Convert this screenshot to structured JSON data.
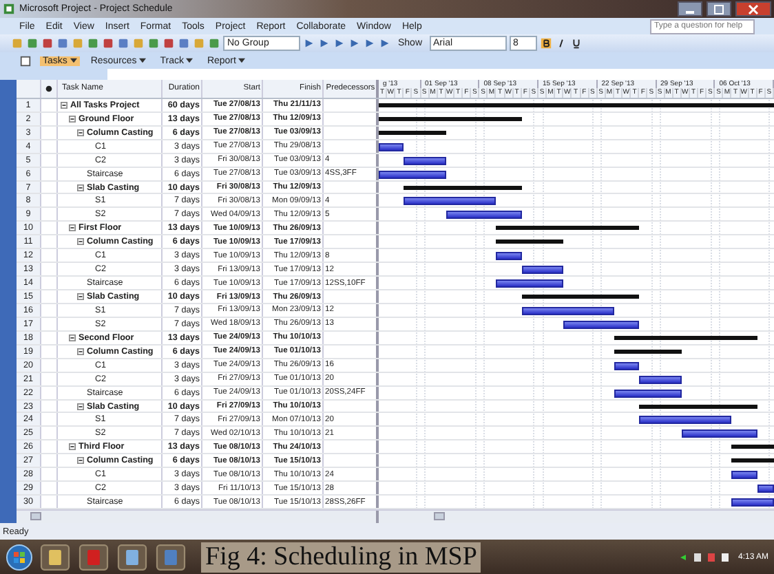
{
  "window": {
    "title": "Microsoft Project - Project Schedule"
  },
  "menu": [
    "File",
    "Edit",
    "View",
    "Insert",
    "Format",
    "Tools",
    "Project",
    "Report",
    "Collaborate",
    "Window",
    "Help"
  ],
  "help_box": {
    "placeholder": "Type a question for help"
  },
  "toolbar": {
    "group": "No Group",
    "show": "Show",
    "font": "Arial",
    "size": "8"
  },
  "view_bar": [
    {
      "label": "Tasks",
      "selected": true
    },
    {
      "label": "Resources",
      "selected": false
    },
    {
      "label": "Track",
      "selected": false
    },
    {
      "label": "Report",
      "selected": false
    }
  ],
  "table": {
    "columns": [
      "Task Name",
      "Duration",
      "Start",
      "Finish",
      "Predecessors"
    ],
    "rows": [
      {
        "num": "1",
        "name": "All Tasks Project",
        "duration": "60 days",
        "start": "Tue 27/08/13",
        "finish": "Thu 21/11/13",
        "expanded": true,
        "children": [
          {
            "num": "2",
            "name": "Ground Floor",
            "duration": "13 days",
            "start": "Tue 27/08/13",
            "finish": "Thu 12/09/13",
            "expanded": true,
            "children": [
              {
                "num": "3",
                "name": "Column Casting",
                "duration": "6 days",
                "start": "Tue 27/08/13",
                "finish": "Tue 03/09/13",
                "expanded": true,
                "children": [
                  {
                    "num": "4",
                    "name": "C1",
                    "duration": "3 days",
                    "start": "Tue 27/08/13",
                    "finish": "Thu 29/08/13"
                  },
                  {
                    "num": "5",
                    "name": "C2",
                    "duration": "3 days",
                    "start": "Fri 30/08/13",
                    "finish": "Tue 03/09/13",
                    "pred": "4"
                  }
                ]
              },
              {
                "num": "6",
                "name": "Staircase",
                "duration": "6 days",
                "start": "Tue 27/08/13",
                "finish": "Tue 03/09/13",
                "pred": "4SS,3FF"
              },
              {
                "num": "7",
                "name": "Slab Casting",
                "duration": "10 days",
                "start": "Fri 30/08/13",
                "finish": "Thu 12/09/13",
                "expanded": true,
                "children": [
                  {
                    "num": "8",
                    "name": "S1",
                    "duration": "7 days",
                    "start": "Fri 30/08/13",
                    "finish": "Mon 09/09/13",
                    "pred": "4"
                  },
                  {
                    "num": "9",
                    "name": "S2",
                    "duration": "7 days",
                    "start": "Wed 04/09/13",
                    "finish": "Thu 12/09/13",
                    "pred": "5"
                  }
                ]
              }
            ]
          },
          {
            "num": "10",
            "name": "First Floor",
            "duration": "13 days",
            "start": "Tue 10/09/13",
            "finish": "Thu 26/09/13",
            "expanded": true,
            "children": [
              {
                "num": "11",
                "name": "Column Casting",
                "duration": "6 days",
                "start": "Tue 10/09/13",
                "finish": "Tue 17/09/13",
                "expanded": true,
                "children": [
                  {
                    "num": "12",
                    "name": "C1",
                    "duration": "3 days",
                    "start": "Tue 10/09/13",
                    "finish": "Thu 12/09/13",
                    "pred": "8"
                  },
                  {
                    "num": "13",
                    "name": "C2",
                    "duration": "3 days",
                    "start": "Fri 13/09/13",
                    "finish": "Tue 17/09/13",
                    "pred": "12"
                  }
                ]
              },
              {
                "num": "14",
                "name": "Staircase",
                "duration": "6 days",
                "start": "Tue 10/09/13",
                "finish": "Tue 17/09/13",
                "pred": "12SS,10FF"
              },
              {
                "num": "15",
                "name": "Slab Casting",
                "duration": "10 days",
                "start": "Fri 13/09/13",
                "finish": "Thu 26/09/13",
                "expanded": true,
                "children": [
                  {
                    "num": "16",
                    "name": "S1",
                    "duration": "7 days",
                    "start": "Fri 13/09/13",
                    "finish": "Mon 23/09/13",
                    "pred": "12"
                  },
                  {
                    "num": "17",
                    "name": "S2",
                    "duration": "7 days",
                    "start": "Wed 18/09/13",
                    "finish": "Thu 26/09/13",
                    "pred": "13"
                  }
                ]
              }
            ]
          },
          {
            "num": "18",
            "name": "Second Floor",
            "duration": "13 days",
            "start": "Tue 24/09/13",
            "finish": "Thu 10/10/13",
            "expanded": true,
            "children": [
              {
                "num": "19",
                "name": "Column Casting",
                "duration": "6 days",
                "start": "Tue 24/09/13",
                "finish": "Tue 01/10/13",
                "expanded": true,
                "children": [
                  {
                    "num": "20",
                    "name": "C1",
                    "duration": "3 days",
                    "start": "Tue 24/09/13",
                    "finish": "Thu 26/09/13",
                    "pred": "16"
                  },
                  {
                    "num": "21",
                    "name": "C2",
                    "duration": "3 days",
                    "start": "Fri 27/09/13",
                    "finish": "Tue 01/10/13",
                    "pred": "20"
                  }
                ]
              },
              {
                "num": "22",
                "name": "Staircase",
                "duration": "6 days",
                "start": "Tue 24/09/13",
                "finish": "Tue 01/10/13",
                "pred": "20SS,24FF"
              },
              {
                "num": "23",
                "name": "Slab Casting",
                "duration": "10 days",
                "start": "Fri 27/09/13",
                "finish": "Thu 10/10/13",
                "expanded": true,
                "children": [
                  {
                    "num": "24",
                    "name": "S1",
                    "duration": "7 days",
                    "start": "Fri 27/09/13",
                    "finish": "Mon 07/10/13",
                    "pred": "20"
                  },
                  {
                    "num": "25",
                    "name": "S2",
                    "duration": "7 days",
                    "start": "Wed 02/10/13",
                    "finish": "Thu 10/10/13",
                    "pred": "21"
                  }
                ]
              }
            ]
          },
          {
            "num": "26",
            "name": "Third Floor",
            "duration": "13 days",
            "start": "Tue 08/10/13",
            "finish": "Thu 24/10/13",
            "expanded": true,
            "children": [
              {
                "num": "27",
                "name": "Column Casting",
                "duration": "6 days",
                "start": "Tue 08/10/13",
                "finish": "Tue 15/10/13",
                "expanded": true,
                "children": [
                  {
                    "num": "28",
                    "name": "C1",
                    "duration": "3 days",
                    "start": "Tue 08/10/13",
                    "finish": "Thu 10/10/13",
                    "pred": "24"
                  },
                  {
                    "num": "29",
                    "name": "C2",
                    "duration": "3 days",
                    "start": "Fri 11/10/13",
                    "finish": "Tue 15/10/13",
                    "pred": "28"
                  }
                ]
              },
              {
                "num": "30",
                "name": "Staircase",
                "duration": "6 days",
                "start": "Tue 08/10/13",
                "finish": "Tue 15/10/13",
                "pred": "28SS,26FF"
              }
            ]
          }
        ]
      }
    ]
  },
  "timescale": {
    "weeks": [
      "g '13",
      "01 Sep '13",
      "08 Sep '13",
      "15 Sep '13",
      "22 Sep '13",
      "29 Sep '13",
      "06 Oct '13"
    ],
    "days": [
      "T",
      "W",
      "T",
      "F",
      "S",
      "S",
      "M",
      "T",
      "W",
      "T",
      "F",
      "S",
      "S",
      "M",
      "T",
      "W",
      "T",
      "F",
      "S",
      "S",
      "M",
      "T",
      "W",
      "T",
      "F",
      "S",
      "S",
      "M",
      "T",
      "W",
      "T",
      "F",
      "S",
      "S",
      "M",
      "T",
      "W",
      "T",
      "F",
      "S",
      "S",
      "M",
      "T",
      "W",
      "T",
      "F",
      "S"
    ]
  },
  "status_bar": {
    "text": "Ready"
  },
  "taskbar": {
    "clock": "4:13 AM"
  },
  "caption": "Fig 4: Scheduling in MSP"
}
